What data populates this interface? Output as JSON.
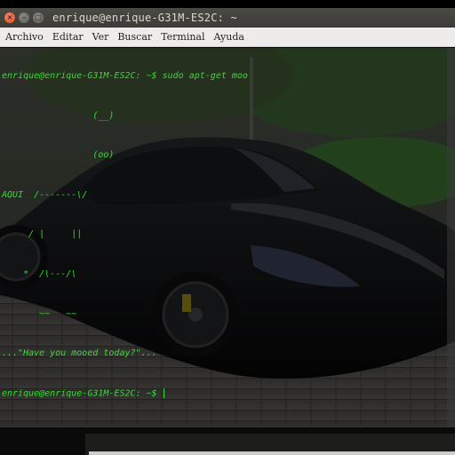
{
  "window": {
    "title": "enrique@enrique-G31M-ES2C: ~",
    "buttons": {
      "close": "×",
      "minimize": "–",
      "maximize": "□"
    }
  },
  "menubar": {
    "items": [
      "Archivo",
      "Editar",
      "Ver",
      "Buscar",
      "Terminal",
      "Ayuda"
    ]
  },
  "terminal": {
    "lines": [
      "enrique@enrique-G31M-ES2C: ~$ sudo apt-get moo",
      "                 (__)",
      "                 (oo)",
      "AQUI  /-------\\/",
      "     / |     ||",
      "    *  /\\---/\\",
      "       ~~   ~~",
      "...\"Have you mooed today?\"...",
      "enrique@enrique-G31M-ES2C: ~$ "
    ],
    "text_color": "#2fe02f",
    "background_description": "black sports car wallpaper"
  },
  "colors": {
    "titlebar": "#3c3b37",
    "close_button": "#df4a16",
    "menubar": "#edeceb"
  }
}
